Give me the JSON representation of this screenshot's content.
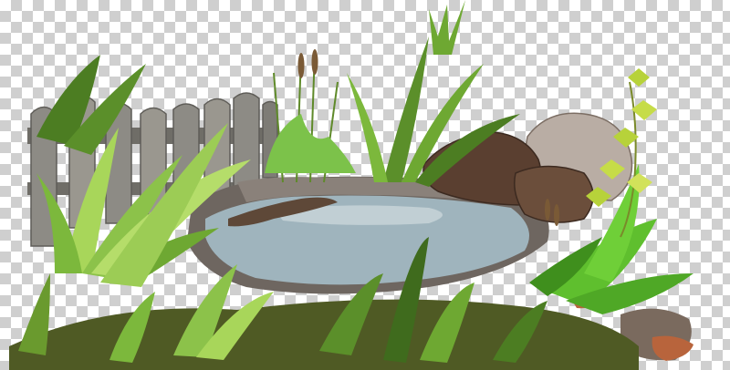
{
  "image": {
    "subject": "pond-garden-cutout",
    "transparency_pattern": {
      "light": "#ffffff",
      "dark": "#cfcfcf"
    }
  },
  "palette": {
    "fence_wood": "#8d8b85",
    "fence_shadow": "#5f5d58",
    "water": "#9fb4bd",
    "water_highlight": "#c9d6da",
    "rock_dark": "#5a3f30",
    "rock_light": "#b9ada4",
    "grass_dark": "#3f6b1d",
    "grass_mid": "#6ea832",
    "grass_light": "#a8d65a",
    "reed_brown": "#7a5a36",
    "moss": "#4f5a24"
  }
}
